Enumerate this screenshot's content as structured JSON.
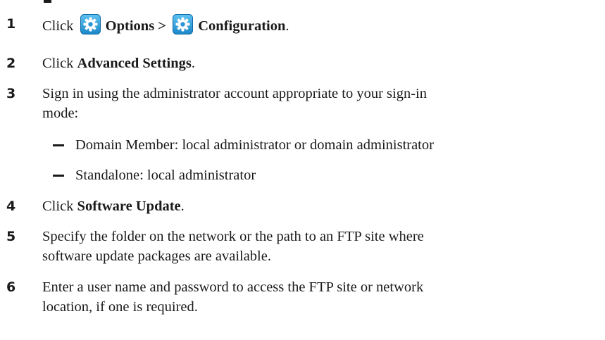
{
  "steps": [
    {
      "number": "1",
      "prefix": "Click",
      "bold1": "Options >",
      "bold2": "Configuration",
      "suffix": "."
    },
    {
      "number": "2",
      "prefix": "Click ",
      "bold": "Advanced Settings",
      "suffix": "."
    },
    {
      "number": "3",
      "line1": "Sign in using the administrator account appropriate to your sign-in",
      "line2": "mode:",
      "subitems": [
        "Domain Member: local administrator or domain administrator",
        "Standalone: local administrator"
      ]
    },
    {
      "number": "4",
      "prefix": "Click ",
      "bold": "Software Update",
      "suffix": "."
    },
    {
      "number": "5",
      "line1": "Specify the folder on the network or the path to an FTP site where",
      "line2": "software update packages are available."
    },
    {
      "number": "6",
      "line1": "Enter a user name and password to access the FTP site or network",
      "line2": "location, if one is required."
    }
  ],
  "icons": {
    "options": "gear-icon",
    "configuration": "gear-icon"
  },
  "colors": {
    "icon_gradient_top": "#5fc3f0",
    "icon_gradient_bottom": "#1a86c8",
    "icon_border": "#0f6aa6",
    "text": "#1a1a1a"
  }
}
